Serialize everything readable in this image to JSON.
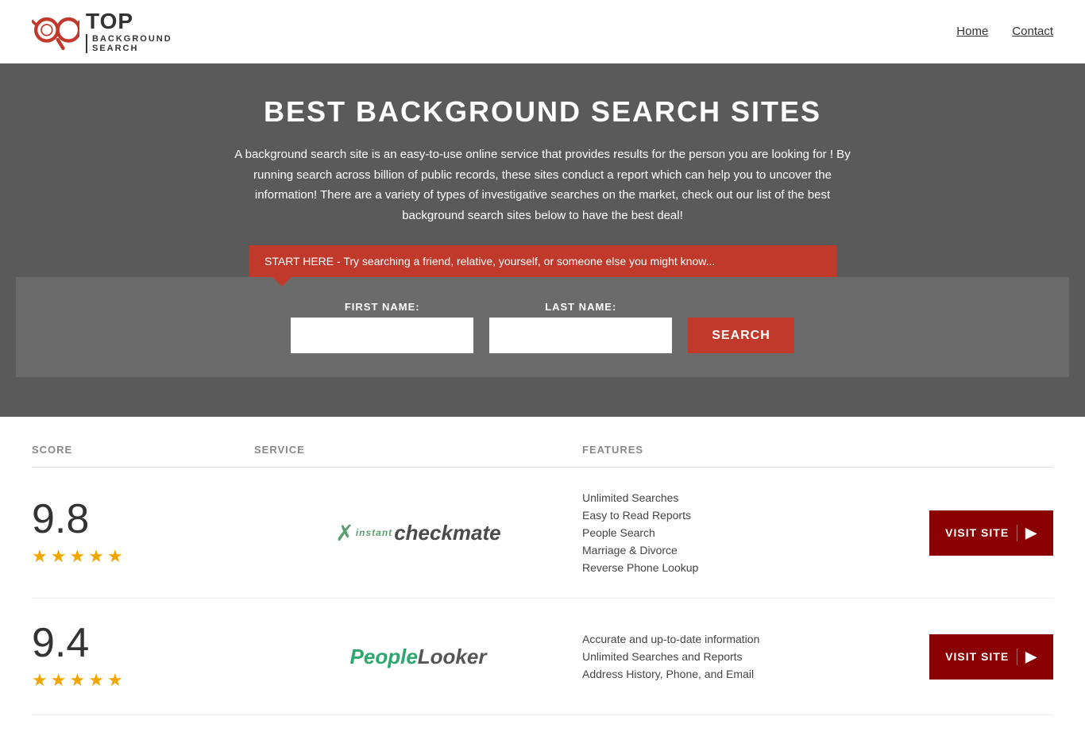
{
  "header": {
    "logo_top": "TOP",
    "logo_bottom": "BACKGROUND\nSEARCH",
    "nav": [
      {
        "label": "Home",
        "href": "#"
      },
      {
        "label": "Contact",
        "href": "#"
      }
    ]
  },
  "hero": {
    "title": "BEST BACKGROUND SEARCH SITES",
    "description": "A background search site is an easy-to-use online service that provides results  for the person you are looking for ! By  running  search across billion of public records, these sites conduct  a report which can help you to uncover the information! There are a variety of types of investigative searches on the market, check out our  list of the best background search sites below to have the best deal!",
    "banner_text": "START HERE - Try searching a friend, relative, yourself, or someone else you might know...",
    "first_name_label": "FIRST NAME:",
    "last_name_label": "LAST NAME:",
    "search_button": "SEARCH"
  },
  "table": {
    "headers": [
      "SCORE",
      "SERVICE",
      "FEATURES",
      ""
    ],
    "rows": [
      {
        "score": "9.8",
        "stars": 4.5,
        "service_name": "Instant Checkmate",
        "service_logo_text": "instant checkmate",
        "features": [
          "Unlimited Searches",
          "Easy to Read Reports",
          "People Search",
          "Marriage & Divorce",
          "Reverse Phone Lookup"
        ],
        "visit_label": "VISIT SITE"
      },
      {
        "score": "9.4",
        "stars": 4.5,
        "service_name": "PeopleLooker",
        "service_logo_text": "PeopleLooker",
        "features": [
          "Accurate and up-to-date information",
          "Unlimited Searches and Reports",
          "Address History, Phone, and Email"
        ],
        "visit_label": "VISIT SITE"
      }
    ]
  }
}
